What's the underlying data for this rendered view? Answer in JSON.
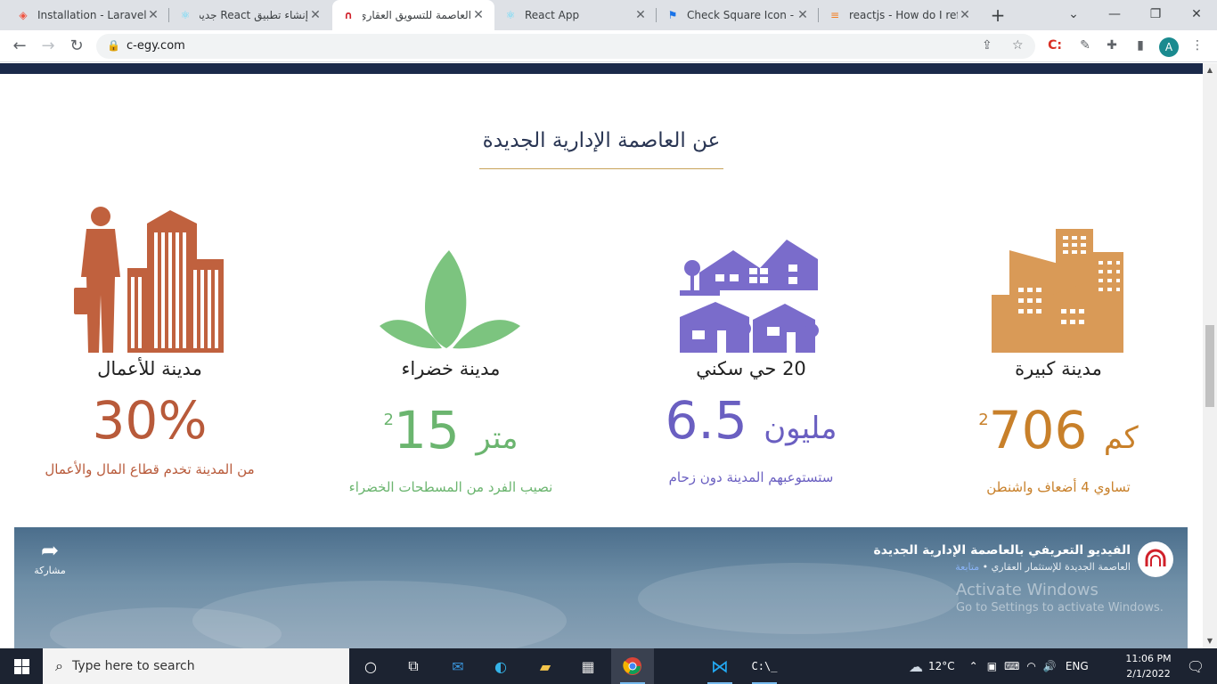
{
  "browser": {
    "tabs": [
      {
        "title": "Installation - Laravel -",
        "icon": "laravel-icon",
        "active": false
      },
      {
        "title": "إنشاء تطبيق React جديد",
        "icon": "react-icon",
        "active": false
      },
      {
        "title": "العاصمة للتسويق العقاري",
        "icon": "c-egy-icon",
        "active": true
      },
      {
        "title": "React App",
        "icon": "react-icon",
        "active": false
      },
      {
        "title": "Check Square Icon - R",
        "icon": "flag-icon",
        "active": false
      },
      {
        "title": "reactjs - How do I refe",
        "icon": "stackoverflow-icon",
        "active": false
      }
    ],
    "url": "c-egy.com",
    "profile_initial": "A"
  },
  "page": {
    "section_title": "عن العاصمة الإدارية الجديدة",
    "stats": [
      {
        "label": "مدينة كبيرة",
        "number": "706",
        "unit": "كم",
        "sup": "2",
        "sub": "تساوي 4 أضعاف واشنطن",
        "color": "#c8802a",
        "icon": "city-buildings-icon"
      },
      {
        "label": "20 حي سكني",
        "number": "6.5",
        "unit": "مليون",
        "sup": "",
        "sub": "ستستوعبهم المدينة دون زحام",
        "color": "#6a5fc1",
        "icon": "houses-icon"
      },
      {
        "label": "مدينة خضراء",
        "number": "15",
        "unit": "متر",
        "sup": "2",
        "sub": "نصيب الفرد من المسطحات الخضراء",
        "color": "#6bb56f",
        "icon": "leaves-icon"
      },
      {
        "label": "مدينة للأعمال",
        "number": "30%",
        "unit": "",
        "sup": "",
        "sub": "من المدينة تخدم قطاع المال والأعمال",
        "color": "#b85a3a",
        "icon": "businessman-icon"
      }
    ],
    "video": {
      "title": "الفيديو التعريفي بالعاصمة الإدارية الجديدة",
      "channel": "العاصمة الجديدة للإستثمار العقاري",
      "follow": "متابعة",
      "share": "مشاركة",
      "activate_line1": "Activate Windows",
      "activate_line2": "Go to Settings to activate Windows."
    }
  },
  "taskbar": {
    "search_placeholder": "Type here to search",
    "weather": "12°C",
    "language": "ENG",
    "time": "11:06 PM",
    "date": "2/1/2022"
  }
}
